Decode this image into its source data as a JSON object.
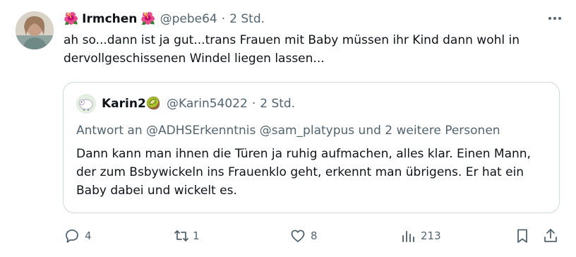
{
  "tweet": {
    "author_name": "Irmchen",
    "name_emoji_left": "🌺",
    "name_emoji_right": "🌺",
    "handle": "@pebe64",
    "separator": "·",
    "time": "2 Std.",
    "text": "ah so...dann ist ja gut...trans Frauen mit Baby müssen ihr Kind dann wohl in dervollgeschissenen Windel liegen lassen...",
    "icons": {
      "avatar": "profile-photo",
      "more": "more-horizontal-icon"
    }
  },
  "quoted_tweet": {
    "author_name": "Karin2",
    "name_emoji": "🥝",
    "handle": "@Karin54022",
    "separator": "·",
    "time": "2 Std.",
    "reply_to": "Antwort an @ADHSErkenntnis @sam_platypus und 2 weitere Personen",
    "text": "Dann kann man ihnen die Türen ja ruhig aufmachen, alles klar. Einen Mann, der zum Bsbywickeln ins Frauenklo geht, erkennt man übrigens. Er hat ein Baby dabei und wickelt es.",
    "icons": {
      "avatar": "sheep-cartoon-avatar"
    }
  },
  "actions": {
    "replies": "4",
    "reposts": "1",
    "likes": "8",
    "views": "213",
    "icons": [
      "reply-icon",
      "repost-icon",
      "like-icon",
      "views-icon",
      "bookmark-icon",
      "share-icon"
    ]
  },
  "colors": {
    "text": "#0f1419",
    "muted": "#536471",
    "border": "#cfd9de"
  }
}
